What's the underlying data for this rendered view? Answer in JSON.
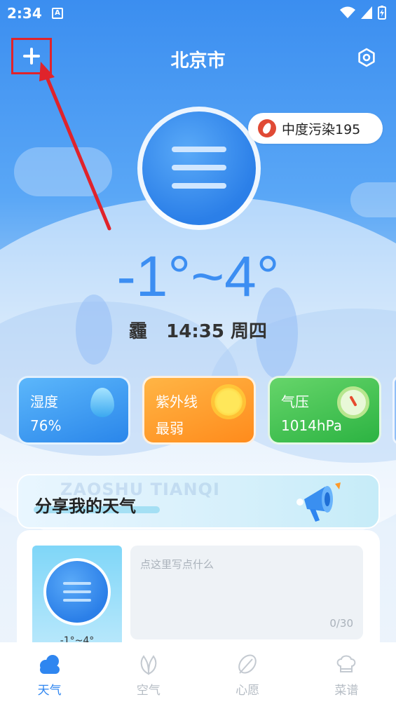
{
  "status_bar": {
    "time": "2:34",
    "notification_icon": "A"
  },
  "header": {
    "city": "北京市",
    "add_icon": "plus-icon",
    "settings_icon": "hexagon-settings-icon"
  },
  "weather": {
    "pollution": "中度污染195",
    "temperature": "-1°~4°",
    "condition": "霾   14:35 周四"
  },
  "stats": {
    "humidity": {
      "label": "湿度",
      "value": "76%",
      "icon": "water-drop-icon"
    },
    "uv": {
      "label": "紫外线",
      "value": "最弱",
      "icon": "sun-icon"
    },
    "pressure": {
      "label": "气压",
      "value": "1014hPa",
      "icon": "gauge-icon"
    }
  },
  "share": {
    "watermark": "ZAOSHU TIANQI",
    "title": "分享我的天气",
    "icon": "megaphone-icon"
  },
  "composer": {
    "placeholder": "点这里写点什么",
    "counter": "0/30",
    "thumb_temp": "-1°~4°"
  },
  "nav": [
    {
      "label": "天气",
      "icon": "cloud-icon",
      "active": true
    },
    {
      "label": "空气",
      "icon": "leaf-icon",
      "active": false
    },
    {
      "label": "心愿",
      "icon": "feather-icon",
      "active": false
    },
    {
      "label": "菜谱",
      "icon": "chef-hat-icon",
      "active": false
    }
  ],
  "colors": {
    "accent": "#2f86f0",
    "annotation": "#e0232b",
    "uv": "#ff9a2a",
    "pressure": "#3dbb4e",
    "humidity": "#3a97f0"
  }
}
